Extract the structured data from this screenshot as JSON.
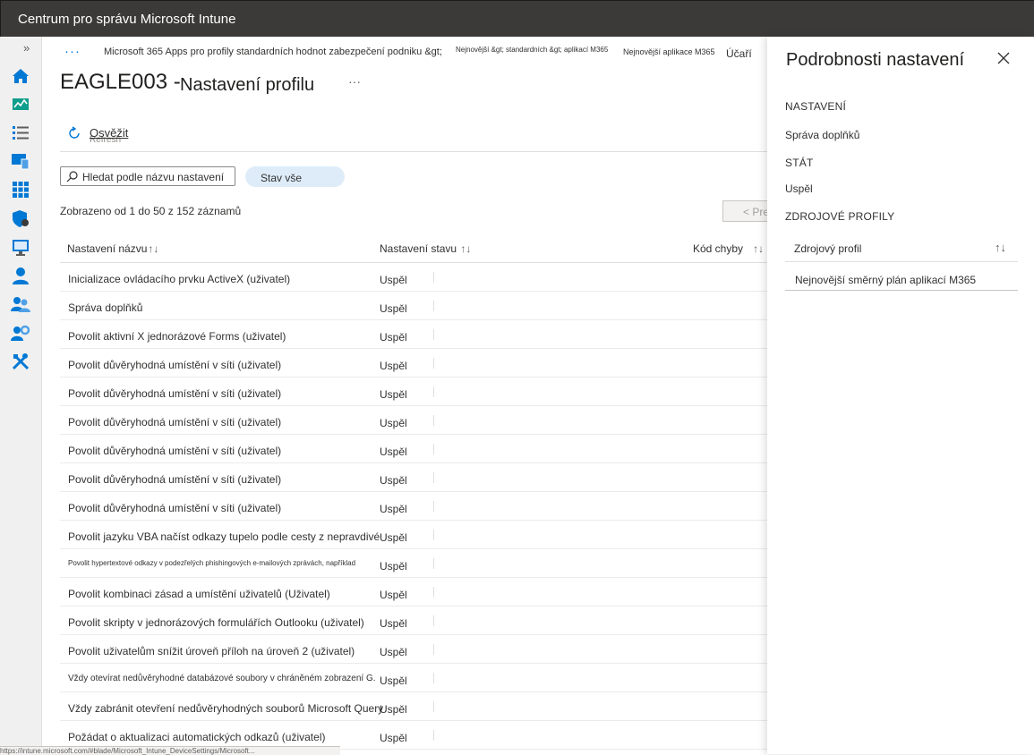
{
  "header": {
    "title": "Centrum pro správu Microsoft Intune"
  },
  "nav": {
    "expand_glyph": "»",
    "items": [
      {
        "icon": "home-icon"
      },
      {
        "icon": "dashboard-icon"
      },
      {
        "icon": "all-services-icon"
      },
      {
        "icon": "devices-icon"
      },
      {
        "icon": "apps-icon"
      },
      {
        "icon": "endpoint-security-icon"
      },
      {
        "icon": "reports-icon"
      },
      {
        "icon": "users-icon"
      },
      {
        "icon": "groups-icon"
      },
      {
        "icon": "tenant-admin-icon"
      },
      {
        "icon": "troubleshooting-icon"
      }
    ]
  },
  "breadcrumb": {
    "overflow": "···",
    "items": [
      "Microsoft 365 Apps pro profily standardních hodnot zabezpečení podniku &gt;",
      "Nejnovější &gt; standardních &gt; aplikací M365",
      "Nejnovější aplikace M365",
      "Účaří"
    ]
  },
  "page": {
    "title": "EAGLE003 -",
    "subtitle": "Nastavení profilu",
    "more": "···"
  },
  "toolbar": {
    "refresh_label": "Osvěžit",
    "refresh_ghost": "Refresh"
  },
  "search": {
    "placeholder": "Hledat podle názvu nastavení"
  },
  "filter": {
    "status_label": "Stav vše"
  },
  "records": {
    "text": "Zobrazeno od 1 do 50 z 152 záznamů"
  },
  "pager": {
    "prev_label": "< Pre"
  },
  "table": {
    "columns": [
      "Nastavení názvu",
      "Nastavení stavu",
      "Kód chyby"
    ],
    "sort_glyph": "↑↓",
    "rows": [
      {
        "name": "Inicializace ovládacího prvku ActiveX (uživatel)",
        "status": "Uspěl"
      },
      {
        "name": "Správa doplňků",
        "status": "Uspěl"
      },
      {
        "name": "Povolit aktivní X jednorázové Forms (uživatel)",
        "status": "Uspěl"
      },
      {
        "name": "Povolit důvěryhodná umístění v síti (uživatel)",
        "status": "Uspěl"
      },
      {
        "name": "Povolit důvěryhodná umístění v síti (uživatel)",
        "status": "Uspěl"
      },
      {
        "name": "Povolit důvěryhodná umístění v síti (uživatel)",
        "status": "Uspěl"
      },
      {
        "name": "Povolit důvěryhodná umístění v síti (uživatel)",
        "status": "Uspěl"
      },
      {
        "name": "Povolit důvěryhodná umístění v síti (uživatel)",
        "status": "Uspěl"
      },
      {
        "name": "Povolit důvěryhodná umístění v síti (uživatel)",
        "status": "Uspěl"
      },
      {
        "name": "Povolit jazyku VBA načíst odkazy tupelo podle cesty z nepravdivé",
        "status": "Uspěl"
      },
      {
        "name": "Povolit hypertextové odkazy v podezřelých phishingových e-mailových zprávách, například",
        "status": "Uspěl"
      },
      {
        "name": "Povolit kombinaci zásad a umístění uživatelů (Uživatel)",
        "status": "Uspěl"
      },
      {
        "name": "Povolit skripty v jednorázových formulářích Outlooku (uživatel)",
        "status": "Uspěl"
      },
      {
        "name": "Povolit uživatelům snížit úroveň příloh na úroveň 2 (uživatel)",
        "status": "Uspěl"
      },
      {
        "name": "Vždy otevírat nedůvěryhodné databázové soubory v chráněném zobrazení G.",
        "status": "Uspěl"
      },
      {
        "name": "Vždy zabránit otevření nedůvěryhodných souborů Microsoft Query",
        "status": "Uspěl"
      },
      {
        "name": "Požádat o aktualizaci automatických odkazů (uživatel)",
        "status": "Uspěl"
      }
    ]
  },
  "panel": {
    "title": "Podrobnosti nastavení",
    "setting_label": "NASTAVENÍ",
    "setting_value": "Správa doplňků",
    "state_label": "STÁT",
    "state_value": "Uspěl",
    "sources_label": "ZDROJOVÉ PROFILY",
    "sources_column": "Zdrojový profil",
    "sort_glyph": "↑↓",
    "sources": [
      "Nejnovější směrný plán aplikací M365"
    ]
  },
  "statusbar": {
    "text": "https://intune.microsoft.com/#blade/Microsoft_Intune_DeviceSettings/Microsoft..."
  }
}
